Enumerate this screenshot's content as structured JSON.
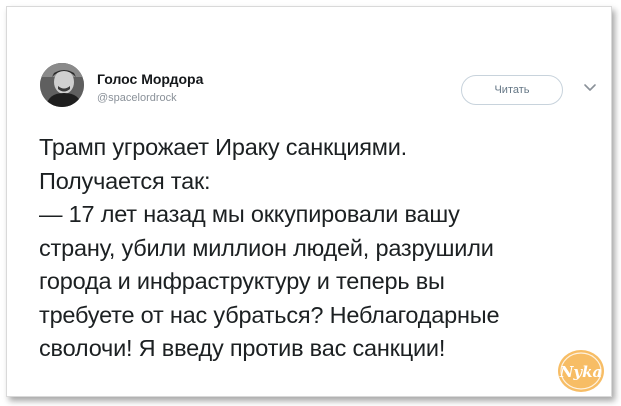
{
  "tweet": {
    "author_name": "Голос Мордора",
    "author_handle": "@spacelordrock",
    "follow_label": "Читать",
    "lines": [
      "Трамп угрожает Ираку санкциями.",
      "Получается так:",
      "— 17 лет назад мы оккупировали вашу",
      "страну, убили миллион людей, разрушили",
      "города и инфраструктуру и теперь вы",
      "требуете от нас убраться? Неблагодарные",
      "сволочи! Я введу против вас санкции!"
    ]
  },
  "watermark": {
    "text": "Nyka",
    "color": "#f5a623"
  },
  "icons": {
    "avatar": "avatar-photo",
    "caret": "chevron-down-icon",
    "watermark": "nyka-logo"
  }
}
